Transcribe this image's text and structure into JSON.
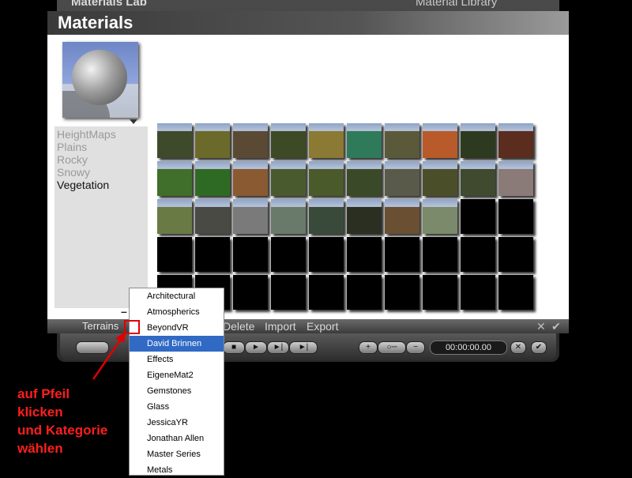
{
  "background_app": {
    "left_tab": "Materials Lab",
    "right_tab": "Material Library"
  },
  "panel": {
    "title": "Materials",
    "categories": [
      {
        "label": "HeightMaps",
        "active": false
      },
      {
        "label": "Plains",
        "active": false
      },
      {
        "label": "Rocky",
        "active": false
      },
      {
        "label": "Snowy",
        "active": false
      },
      {
        "label": "Vegetation",
        "active": true
      }
    ],
    "grid": {
      "columns": 10,
      "rows": 5,
      "filled_colors": [
        [
          "#3f4a2b",
          "#6b6a2a",
          "#5a4a33",
          "#3e4a25",
          "#8a7a33",
          "#2e7a5a",
          "#5a5a3a",
          "#b85a2a",
          "#2d3a1f",
          "#5a2d1f"
        ],
        [
          "#3f6f2b",
          "#2e6a24",
          "#8a5a33",
          "#4a5a2f",
          "#4a5a2a",
          "#3a4a28",
          "#5a5a4a",
          "#4a4f2a",
          "#3f4a2e",
          "#8a7a78"
        ],
        [
          "#6a7a45",
          "#4a4a44",
          "#7a7a7a",
          "#6a7a6a",
          "#3a4a3a",
          "#2a2f22",
          "#6a4f33",
          "#7a8a6a"
        ]
      ]
    },
    "footer": {
      "dropdown_label": "Terrains",
      "delete_label": "Delete",
      "import_label": "Import",
      "export_label": "Export",
      "cancel_icon": "✕",
      "ok_icon": "✔"
    },
    "minus_label": "–"
  },
  "timeline": {
    "time": "00:00:00.00"
  },
  "dropdown_menu": {
    "selected_index": 3,
    "items": [
      "Architectural",
      "Atmospherics",
      "BeyondVR",
      "David Brinnen",
      "Effects",
      "EigeneMat2",
      "Gemstones",
      "Glass",
      "JessicaYR",
      "Jonathan Allen",
      "Master Series",
      "Metals"
    ]
  },
  "annotation": {
    "text": "auf Pfeil\nklicken\nund Kategorie\nwählen",
    "color": "#ff1e1e"
  }
}
